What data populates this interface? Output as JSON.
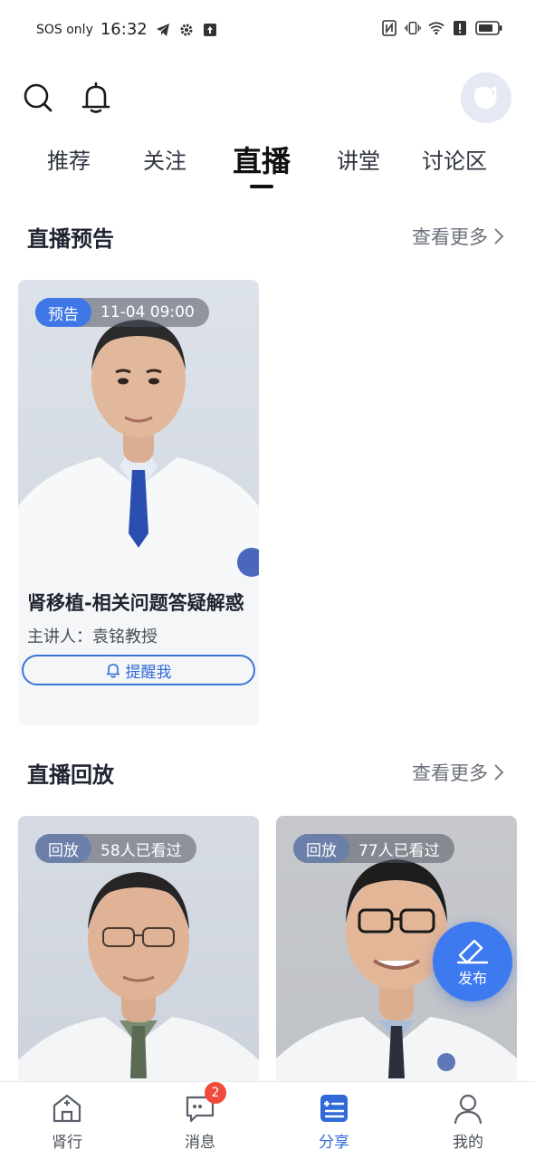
{
  "status_bar": {
    "sos": "SOS only",
    "time": "16:32"
  },
  "header": {
    "search_icon": "search-icon",
    "bell_icon": "bell-icon",
    "avatar_icon": "avatar"
  },
  "tabs": [
    {
      "label": "推荐",
      "active": false
    },
    {
      "label": "关注",
      "active": false
    },
    {
      "label": "直播",
      "active": true
    },
    {
      "label": "讲堂",
      "active": false
    },
    {
      "label": "讨论区",
      "active": false
    }
  ],
  "preview_section": {
    "title": "直播预告",
    "more": "查看更多",
    "card": {
      "tag": "预告",
      "time": "11-04 09:00",
      "title": "肾移植-相关问题答疑解惑",
      "speaker": "主讲人：袁铭教授",
      "remind": "提醒我"
    }
  },
  "replay_section": {
    "title": "直播回放",
    "more": "查看更多",
    "cards": [
      {
        "tag": "回放",
        "views": "58人已看过"
      },
      {
        "tag": "回放",
        "views": "77人已看过"
      }
    ]
  },
  "fab": {
    "label": "发布"
  },
  "bottom_nav": [
    {
      "label": "肾行",
      "icon": "home-cross-icon",
      "active": false
    },
    {
      "label": "消息",
      "icon": "message-icon",
      "active": false,
      "badge": "2"
    },
    {
      "label": "分享",
      "icon": "share-list-icon",
      "active": true
    },
    {
      "label": "我的",
      "icon": "person-icon",
      "active": false
    }
  ],
  "colors": {
    "accent": "#2f6ad8",
    "preview_tag": "#3f78e6",
    "replay_tag": "#6b7fa8",
    "badge": "#f04a3a"
  }
}
